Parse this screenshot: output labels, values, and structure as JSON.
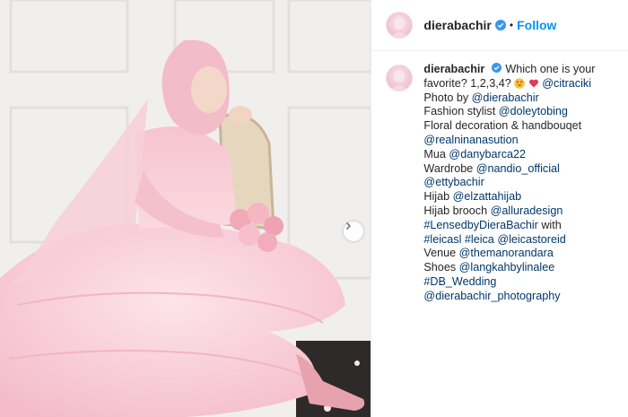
{
  "header": {
    "username": "dierabachir",
    "separator": "•",
    "follow_label": "Follow"
  },
  "caption": {
    "username": "dierabachir",
    "text_1": "Which one is your",
    "text_2": "favorite? 1,2,3,4?",
    "mention_1": "@citraciki",
    "l3_text": "Photo by ",
    "l3_mention": "@dierabachir",
    "l4_text": "Fashion stylist ",
    "l4_mention": "@doleytobing",
    "l5_text": "Floral decoration & handbouqet",
    "l6_mention": "@realninanasution",
    "l7_text": "Mua ",
    "l7_mention": "@danybarca22",
    "l8_text": "Wardrobe ",
    "l8_mention": "@nandio_official",
    "l9_mention": "@ettybachir",
    "l10_text": "Hijab ",
    "l10_mention": "@elzattahijab",
    "l11_text": "Hijab brooch ",
    "l11_mention": "@alluradesign",
    "l12_mention": "#LensedbyDieraBachir",
    "l12_text": " with",
    "l13_mention_a": "#leicasl",
    "l13_mention_b": "#leica",
    "l13_mention_c": "@leicastoreid",
    "l14_text": "Venue ",
    "l14_mention": "@themanorandara",
    "l15_text": "Shoes ",
    "l15_mention": "@langkahbylinalee",
    "l16_mention": "#DB_Wedding",
    "l17_mention": "@dierabachir_photography"
  },
  "colors": {
    "link": "#00376b",
    "follow": "#0095f6",
    "verified": "#3897f0",
    "text": "#262626",
    "dress": "#f7c9d3"
  },
  "icons": {
    "verified": "verified-badge-icon",
    "next": "chevron-right-icon",
    "emoji_1": "heart-eyes-emoji-icon",
    "emoji_2": "sparkling-heart-emoji-icon"
  }
}
